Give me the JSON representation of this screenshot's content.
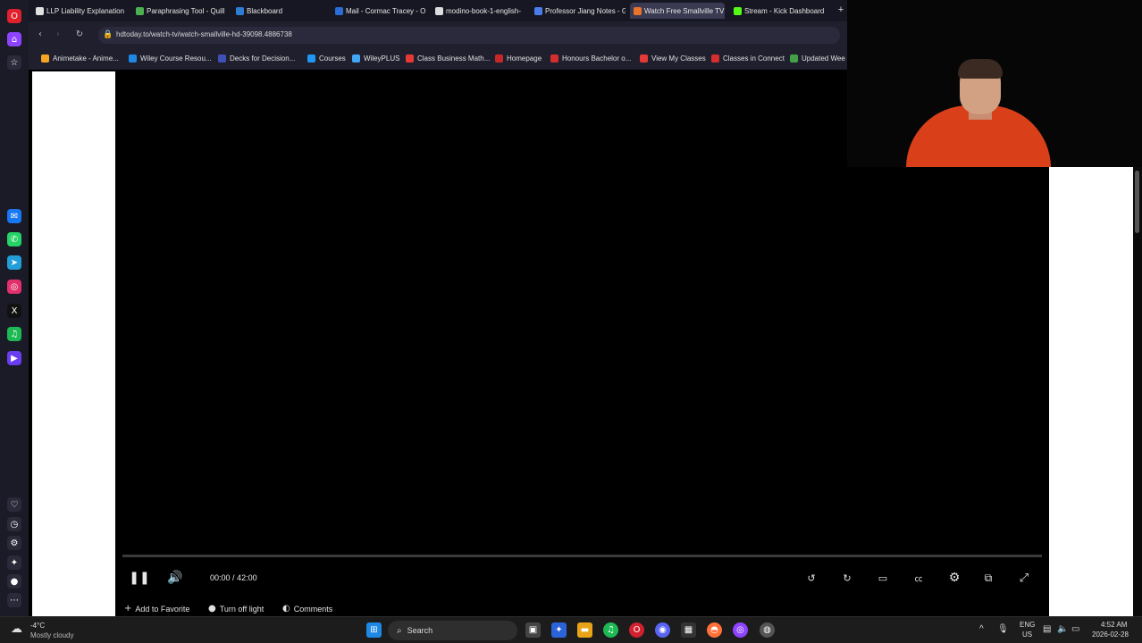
{
  "browser": {
    "tabs": [
      {
        "label": "LLP Liability Explanation",
        "color": "#e0e0e0"
      },
      {
        "label": "Paraphrasing Tool - Quill",
        "color": "#4caf50"
      },
      {
        "label": "Blackboard",
        "color": "#2d7dd2"
      },
      {
        "label": "Mail - Cormac Tracey - O",
        "color": "#2b6cd6"
      },
      {
        "label": "modino-book-1-english-",
        "color": "#dddddd"
      },
      {
        "label": "Professor Jiang Notes - G",
        "color": "#4a7de8"
      },
      {
        "label": "Watch Free Smallville TV",
        "color": "#e8732b",
        "active": true
      },
      {
        "label": "Stream - Kick Dashboard",
        "color": "#53fc18"
      }
    ],
    "url": "hdtoday.to/watch-tv/watch-smallville-hd-39098.4886738",
    "bookmarks": [
      {
        "label": "Animetake - Anime...",
        "color": "#f6a623"
      },
      {
        "label": "Wiley Course Resou...",
        "color": "#1e88e5"
      },
      {
        "label": "Decks for Decision...",
        "color": "#3f51b5"
      },
      {
        "label": "Courses",
        "color": "#2196f3"
      },
      {
        "label": "WileyPLUS",
        "color": "#42a5f5"
      },
      {
        "label": "Class Business Math...",
        "color": "#e53935"
      },
      {
        "label": "Homepage",
        "color": "#c62828"
      },
      {
        "label": "Honours Bachelor o...",
        "color": "#d32f2f"
      },
      {
        "label": "View My Classes",
        "color": "#e53935"
      },
      {
        "label": "Classes in Connect",
        "color": "#d32f2f"
      },
      {
        "label": "Updated Wee",
        "color": "#43a047"
      }
    ]
  },
  "sidebar": {
    "icons": [
      {
        "name": "opera-logo-icon",
        "glyph": "O",
        "color": "#e0202b"
      },
      {
        "name": "home-icon",
        "glyph": "⌂",
        "color": "#8e44ff"
      },
      {
        "name": "star-icon",
        "glyph": "☆",
        "color": "#2a2a3a"
      },
      {
        "name": "messenger-icon",
        "glyph": "✉",
        "color": "#1877f2"
      },
      {
        "name": "whatsapp-icon",
        "glyph": "✆",
        "color": "#25d366"
      },
      {
        "name": "telegram-icon",
        "glyph": "➤",
        "color": "#229ed9"
      },
      {
        "name": "instagram-icon",
        "glyph": "◎",
        "color": "#e1306c"
      },
      {
        "name": "x-icon",
        "glyph": "X",
        "color": "#111111"
      },
      {
        "name": "spotify-icon",
        "glyph": "♫",
        "color": "#1db954"
      },
      {
        "name": "player-icon",
        "glyph": "▶",
        "color": "#6b3df0"
      },
      {
        "name": "heart-icon",
        "glyph": "♡",
        "color": "#2a2a3a"
      },
      {
        "name": "history-icon",
        "glyph": "◷",
        "color": "#2a2a3a"
      },
      {
        "name": "settings-icon",
        "glyph": "⚙",
        "color": "#2a2a3a"
      },
      {
        "name": "lightbulb-icon",
        "glyph": "✦",
        "color": "#2a2a3a"
      },
      {
        "name": "vpn-icon",
        "glyph": "●",
        "color": "#2a2a3a"
      },
      {
        "name": "more-icon",
        "glyph": "⋯",
        "color": "#2a2a3a"
      }
    ]
  },
  "player": {
    "time_current": "00:00",
    "time_separator": "/",
    "time_total": "42:00",
    "progress_fraction": 0.0,
    "add_favorite": "Add to Favorite",
    "turn_off_light": "Turn off light",
    "comments": "Comments"
  },
  "taskbar": {
    "weather_temp": "-4°C",
    "weather_desc": "Mostly cloudy",
    "search_placeholder": "Search",
    "lang_top": "ENG",
    "lang_bottom": "US",
    "clock_time": "4:52 AM",
    "clock_date": "2026-02-28"
  }
}
